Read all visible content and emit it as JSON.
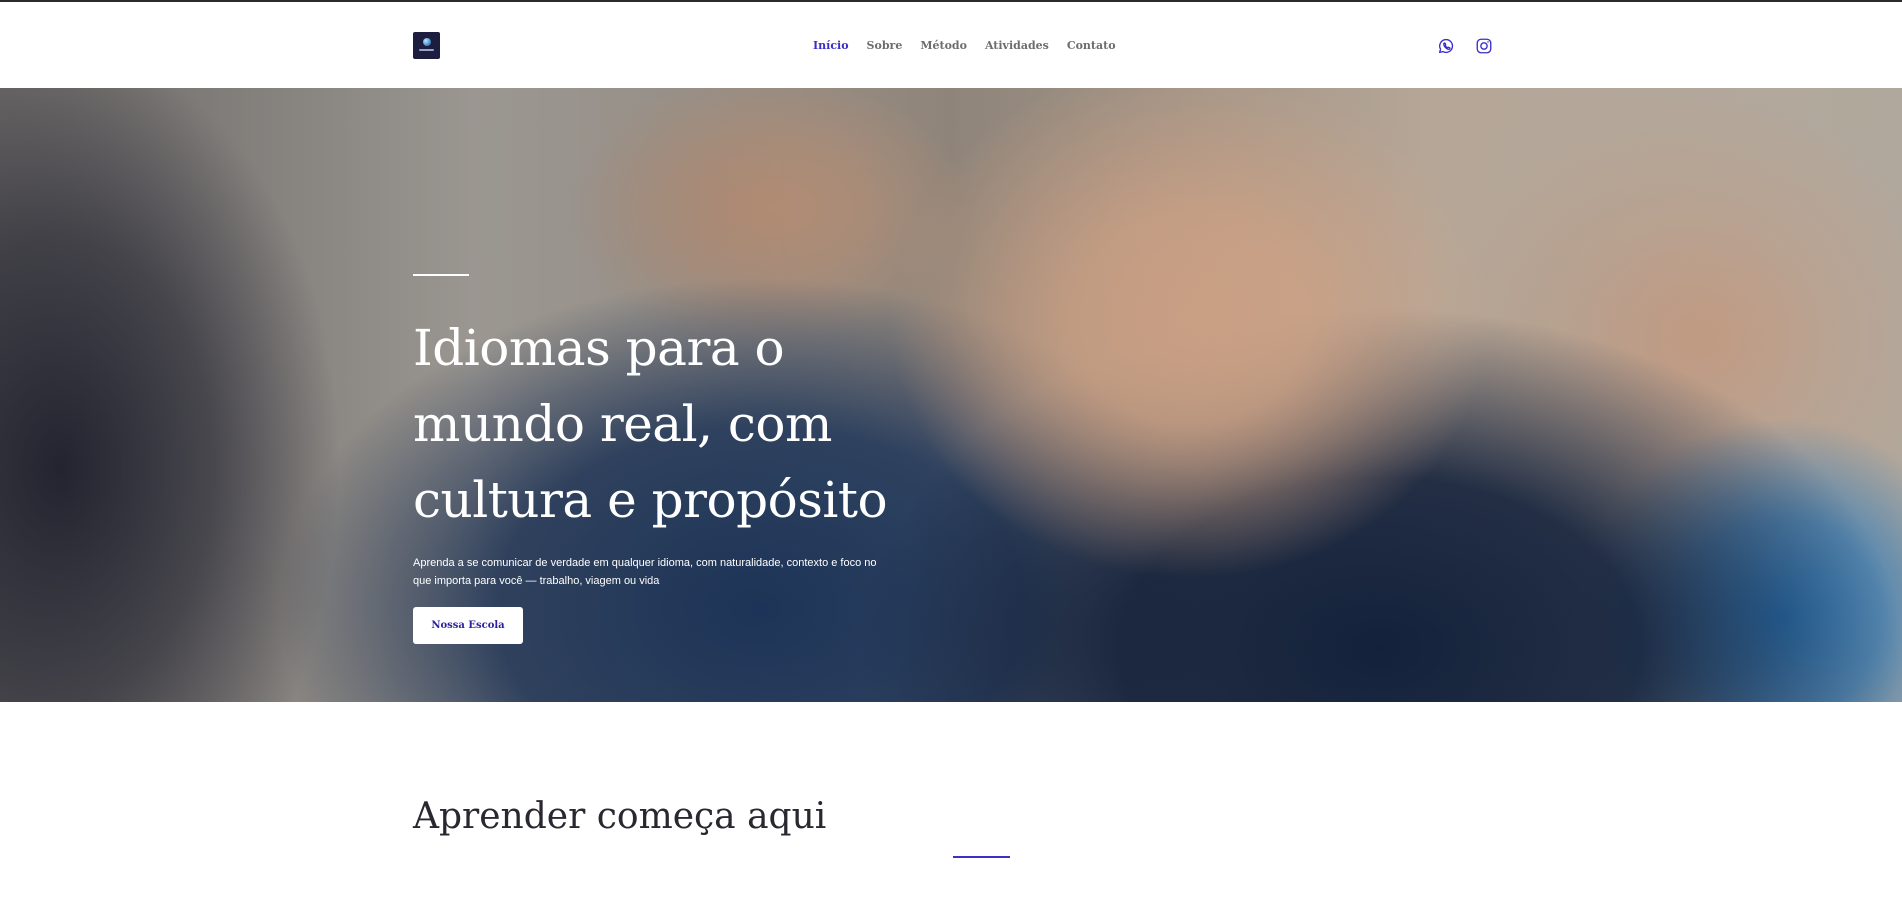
{
  "brand": {
    "logo_icon": "globe-logo-icon"
  },
  "nav": {
    "items": [
      {
        "label": "Início",
        "active": true
      },
      {
        "label": "Sobre",
        "active": false
      },
      {
        "label": "Método",
        "active": false
      },
      {
        "label": "Atividades",
        "active": false
      },
      {
        "label": "Contato",
        "active": false
      }
    ],
    "active_color": "#3b2fc9",
    "inactive_color": "#6f6b6f"
  },
  "social": [
    {
      "icon": "whatsapp-icon"
    },
    {
      "icon": "instagram-icon"
    }
  ],
  "hero": {
    "title": "Idiomas para o mundo real, com cultura e propósito",
    "subtitle": "Aprenda a se comunicar de verdade em qualquer idioma, com naturalidade, contexto e foco no que importa para você — trabalho, viagem ou vida",
    "cta_label": "Nossa Escola"
  },
  "section": {
    "title": "Aprender começa aqui"
  },
  "colors": {
    "accent": "#3b2fc9",
    "text_dark": "#2a2730"
  }
}
